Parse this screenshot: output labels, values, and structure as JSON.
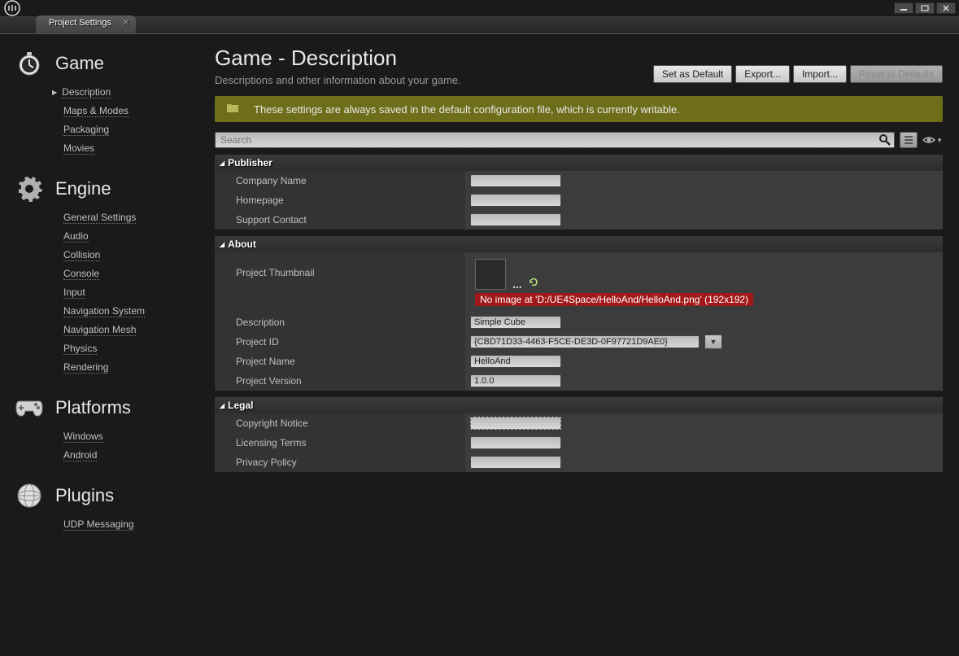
{
  "titlebar": {
    "tab": "Project Settings"
  },
  "sidebar": [
    {
      "title": "Game",
      "icon": "stopwatch",
      "items": [
        "Description",
        "Maps & Modes",
        "Packaging",
        "Movies"
      ],
      "active": 0
    },
    {
      "title": "Engine",
      "icon": "gear",
      "items": [
        "General Settings",
        "Audio",
        "Collision",
        "Console",
        "Input",
        "Navigation System",
        "Navigation Mesh",
        "Physics",
        "Rendering"
      ]
    },
    {
      "title": "Platforms",
      "icon": "gamepad",
      "items": [
        "Windows",
        "Android"
      ]
    },
    {
      "title": "Plugins",
      "icon": "globe",
      "items": [
        "UDP Messaging"
      ]
    }
  ],
  "header": {
    "title": "Game - Description",
    "subtitle": "Descriptions and other information about your game.",
    "buttons": {
      "setdefault": "Set as Default",
      "export": "Export...",
      "import": "Import...",
      "reset": "Reset to Defaults"
    }
  },
  "notice": "These settings are always saved in the default configuration file, which is currently writable.",
  "search": {
    "placeholder": "Search"
  },
  "sections": {
    "publisher": {
      "title": "Publisher",
      "rows": [
        {
          "label": "Company Name",
          "value": ""
        },
        {
          "label": "Homepage",
          "value": ""
        },
        {
          "label": "Support Contact",
          "value": ""
        }
      ]
    },
    "about": {
      "title": "About",
      "thumbnail": {
        "label": "Project Thumbnail",
        "error": "No image at 'D:/UE4Space/HelloAnd/HelloAnd.png' (192x192)",
        "dots": "..."
      },
      "rows": [
        {
          "label": "Description",
          "value": "Simple Cube"
        },
        {
          "label": "Project ID",
          "value": "{CBD71D33-4463-F5CE-DE3D-0F97721D9AE0}",
          "wide": true,
          "dropdown": true
        },
        {
          "label": "Project Name",
          "value": "HelloAnd"
        },
        {
          "label": "Project Version",
          "value": "1.0.0"
        }
      ]
    },
    "legal": {
      "title": "Legal",
      "rows": [
        {
          "label": "Copyright Notice",
          "value": "",
          "dashed": true
        },
        {
          "label": "Licensing Terms",
          "value": ""
        },
        {
          "label": "Privacy Policy",
          "value": ""
        }
      ]
    }
  }
}
